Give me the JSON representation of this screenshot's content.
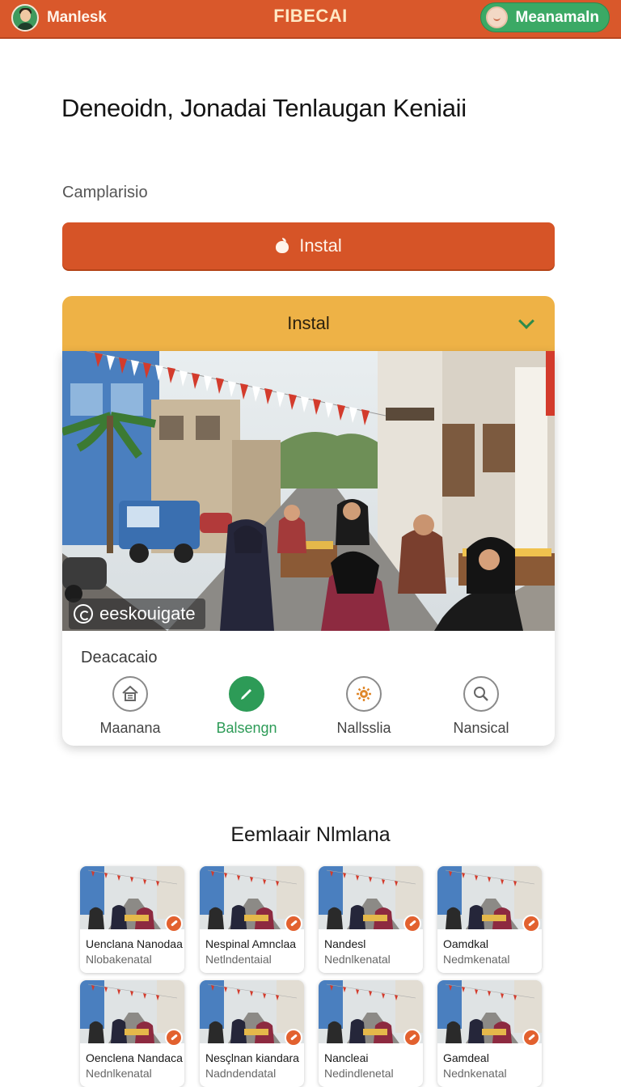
{
  "header": {
    "user_name": "Manlesk",
    "app_title": "FIBECAI",
    "account_label": "Meanamaln"
  },
  "page": {
    "title": "Deneoidn, Jonadai Tenlaugan Keniaii",
    "subtitle": "Camplarisio",
    "primary_button": "Instal",
    "dropdown_label": "Instal"
  },
  "card": {
    "caption": "eeskouigate",
    "section_label": "Deacacaio",
    "actions": [
      {
        "label": "Maanana",
        "icon": "home-icon",
        "active": false
      },
      {
        "label": "Balsengn",
        "icon": "edit-icon",
        "active": true
      },
      {
        "label": "Nallsslia",
        "icon": "settings-icon",
        "active": false
      },
      {
        "label": "Nansical",
        "icon": "search-icon",
        "active": false
      }
    ]
  },
  "gallery": {
    "title": "Eemlaair Nlmlana",
    "items": [
      {
        "title": "Uenclana Nanodaa",
        "subtitle": "Nlobakenatal"
      },
      {
        "title": "Nespinal Amnclaa",
        "subtitle": "Netlndentaial"
      },
      {
        "title": "Nandesl",
        "subtitle": "Nednlkenatal"
      },
      {
        "title": "Oamdkal",
        "subtitle": "Nedmkenatal"
      },
      {
        "title": "Oenclena Nandaca",
        "subtitle": "Nednlkenatal"
      },
      {
        "title": "Nesçlnan kiandara",
        "subtitle": "Nadndendatal"
      },
      {
        "title": "Nancleai",
        "subtitle": "Nedindlenetal"
      },
      {
        "title": "Gamdeal",
        "subtitle": "Nednkenatal"
      }
    ]
  },
  "colors": {
    "header_bg": "#d9582b",
    "primary": "#d65427",
    "dropdown_bg": "#eeb246",
    "accent_green": "#2d9b57"
  }
}
